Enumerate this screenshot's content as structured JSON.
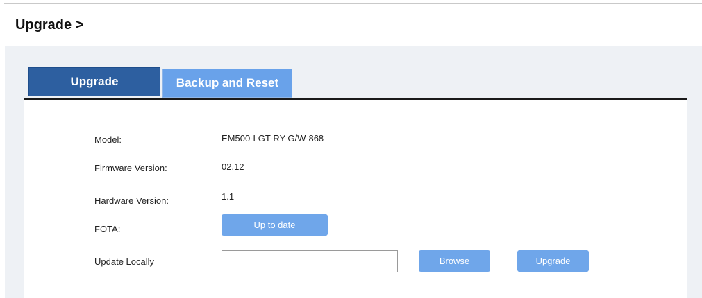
{
  "header": {
    "title": "Upgrade >"
  },
  "tabs": [
    {
      "label": "Upgrade",
      "active": true
    },
    {
      "label": "Backup and Reset",
      "active": false
    }
  ],
  "info": {
    "model_label": "Model:",
    "model_value": "EM500-LGT-RY-G/W-868",
    "firmware_label": "Firmware Version:",
    "firmware_value": "02.12",
    "hardware_label": "Hardware Version:",
    "hardware_value": "1.1",
    "fota_label": "FOTA:",
    "fota_button": "Up to date",
    "update_label": "Update Locally",
    "update_input_value": "",
    "browse_button": "Browse",
    "upgrade_button": "Upgrade"
  },
  "colors": {
    "active_tab": "#2d5fa0",
    "inactive_tab": "#69a2ea",
    "button": "#6fa6ea",
    "panel_bg": "#eef1f5"
  }
}
